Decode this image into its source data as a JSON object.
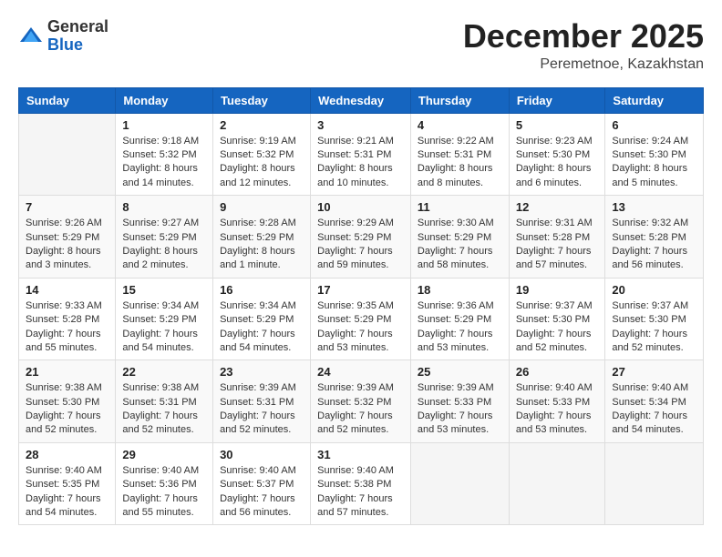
{
  "header": {
    "logo": {
      "general": "General",
      "blue": "Blue"
    },
    "title": "December 2025",
    "location": "Peremetnoe, Kazakhstan"
  },
  "calendar": {
    "days_of_week": [
      "Sunday",
      "Monday",
      "Tuesday",
      "Wednesday",
      "Thursday",
      "Friday",
      "Saturday"
    ],
    "weeks": [
      [
        {
          "day": "",
          "info": ""
        },
        {
          "day": "1",
          "info": "Sunrise: 9:18 AM\nSunset: 5:32 PM\nDaylight: 8 hours\nand 14 minutes."
        },
        {
          "day": "2",
          "info": "Sunrise: 9:19 AM\nSunset: 5:32 PM\nDaylight: 8 hours\nand 12 minutes."
        },
        {
          "day": "3",
          "info": "Sunrise: 9:21 AM\nSunset: 5:31 PM\nDaylight: 8 hours\nand 10 minutes."
        },
        {
          "day": "4",
          "info": "Sunrise: 9:22 AM\nSunset: 5:31 PM\nDaylight: 8 hours\nand 8 minutes."
        },
        {
          "day": "5",
          "info": "Sunrise: 9:23 AM\nSunset: 5:30 PM\nDaylight: 8 hours\nand 6 minutes."
        },
        {
          "day": "6",
          "info": "Sunrise: 9:24 AM\nSunset: 5:30 PM\nDaylight: 8 hours\nand 5 minutes."
        }
      ],
      [
        {
          "day": "7",
          "info": "Sunrise: 9:26 AM\nSunset: 5:29 PM\nDaylight: 8 hours\nand 3 minutes."
        },
        {
          "day": "8",
          "info": "Sunrise: 9:27 AM\nSunset: 5:29 PM\nDaylight: 8 hours\nand 2 minutes."
        },
        {
          "day": "9",
          "info": "Sunrise: 9:28 AM\nSunset: 5:29 PM\nDaylight: 8 hours\nand 1 minute."
        },
        {
          "day": "10",
          "info": "Sunrise: 9:29 AM\nSunset: 5:29 PM\nDaylight: 7 hours\nand 59 minutes."
        },
        {
          "day": "11",
          "info": "Sunrise: 9:30 AM\nSunset: 5:29 PM\nDaylight: 7 hours\nand 58 minutes."
        },
        {
          "day": "12",
          "info": "Sunrise: 9:31 AM\nSunset: 5:28 PM\nDaylight: 7 hours\nand 57 minutes."
        },
        {
          "day": "13",
          "info": "Sunrise: 9:32 AM\nSunset: 5:28 PM\nDaylight: 7 hours\nand 56 minutes."
        }
      ],
      [
        {
          "day": "14",
          "info": "Sunrise: 9:33 AM\nSunset: 5:28 PM\nDaylight: 7 hours\nand 55 minutes."
        },
        {
          "day": "15",
          "info": "Sunrise: 9:34 AM\nSunset: 5:29 PM\nDaylight: 7 hours\nand 54 minutes."
        },
        {
          "day": "16",
          "info": "Sunrise: 9:34 AM\nSunset: 5:29 PM\nDaylight: 7 hours\nand 54 minutes."
        },
        {
          "day": "17",
          "info": "Sunrise: 9:35 AM\nSunset: 5:29 PM\nDaylight: 7 hours\nand 53 minutes."
        },
        {
          "day": "18",
          "info": "Sunrise: 9:36 AM\nSunset: 5:29 PM\nDaylight: 7 hours\nand 53 minutes."
        },
        {
          "day": "19",
          "info": "Sunrise: 9:37 AM\nSunset: 5:30 PM\nDaylight: 7 hours\nand 52 minutes."
        },
        {
          "day": "20",
          "info": "Sunrise: 9:37 AM\nSunset: 5:30 PM\nDaylight: 7 hours\nand 52 minutes."
        }
      ],
      [
        {
          "day": "21",
          "info": "Sunrise: 9:38 AM\nSunset: 5:30 PM\nDaylight: 7 hours\nand 52 minutes."
        },
        {
          "day": "22",
          "info": "Sunrise: 9:38 AM\nSunset: 5:31 PM\nDaylight: 7 hours\nand 52 minutes."
        },
        {
          "day": "23",
          "info": "Sunrise: 9:39 AM\nSunset: 5:31 PM\nDaylight: 7 hours\nand 52 minutes."
        },
        {
          "day": "24",
          "info": "Sunrise: 9:39 AM\nSunset: 5:32 PM\nDaylight: 7 hours\nand 52 minutes."
        },
        {
          "day": "25",
          "info": "Sunrise: 9:39 AM\nSunset: 5:33 PM\nDaylight: 7 hours\nand 53 minutes."
        },
        {
          "day": "26",
          "info": "Sunrise: 9:40 AM\nSunset: 5:33 PM\nDaylight: 7 hours\nand 53 minutes."
        },
        {
          "day": "27",
          "info": "Sunrise: 9:40 AM\nSunset: 5:34 PM\nDaylight: 7 hours\nand 54 minutes."
        }
      ],
      [
        {
          "day": "28",
          "info": "Sunrise: 9:40 AM\nSunset: 5:35 PM\nDaylight: 7 hours\nand 54 minutes."
        },
        {
          "day": "29",
          "info": "Sunrise: 9:40 AM\nSunset: 5:36 PM\nDaylight: 7 hours\nand 55 minutes."
        },
        {
          "day": "30",
          "info": "Sunrise: 9:40 AM\nSunset: 5:37 PM\nDaylight: 7 hours\nand 56 minutes."
        },
        {
          "day": "31",
          "info": "Sunrise: 9:40 AM\nSunset: 5:38 PM\nDaylight: 7 hours\nand 57 minutes."
        },
        {
          "day": "",
          "info": ""
        },
        {
          "day": "",
          "info": ""
        },
        {
          "day": "",
          "info": ""
        }
      ]
    ]
  }
}
